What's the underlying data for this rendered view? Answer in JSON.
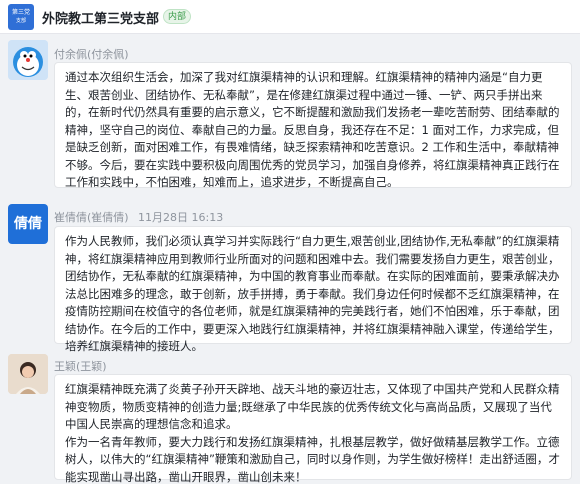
{
  "header": {
    "group_avatar_line1": "第三党",
    "group_avatar_line2": "支部",
    "title": "外院教工第三党支部",
    "badge": "内部"
  },
  "messages": [
    {
      "sender": "付余佩(付余佩)",
      "avatar_icon": "cartoon-avatar-icon",
      "text": "通过本次组织生活会，加深了我对红旗渠精神的认识和理解。红旗渠精神的精神内涵是“自力更生、艰苦创业、团结协作、无私奉献”，是在修建红旗渠过程中通过一锤、一铲、两只手拼出来的，在新时代仍然具有重要的启示意义，它不断提醒和激励我们发扬老一辈吃苦耐劳、团结奉献的精神，坚守自己的岗位、奉献自己的力量。反思自身，我还存在不足：1 面对工作，力求完成，但是缺乏创新，面对困难工作，有畏难情绪，缺乏探索精神和吃苦意识。2 工作和生活中，奉献精神不够。今后，要在实践中要积极向周围优秀的党员学习，加强自身修养，将红旗渠精神真正践行在工作和实践中，不怕困难，知难而上，追求进步，不断提高自己。"
    },
    {
      "sender": "崔倩倩(崔倩倩)",
      "avatar_text": "倩倩",
      "time": "11月28日 16:13",
      "text": "作为人民教师，我们必须认真学习并实际践行“自力更生,艰苦创业,团结协作,无私奉献”的红旗渠精神，将红旗渠精神应用到教师行业所面对的问题和困难中去。我们需要发扬自力更生，艰苦创业，团结协作，无私奉献的红旗渠精神，为中国的教育事业而奉献。在实际的困难面前，要秉承解决办法总比困难多的理念，敢于创新，放手拼搏，勇于奉献。我们身边任何时候都不乏红旗渠精神，在疫情防控期间在校值守的各位老师，就是红旗渠精神的完美践行者，她们不怕困难，乐于奉献，团结协作。在今后的工作中，要更深入地践行红旗渠精神，并将红旗渠精神融入课堂，传递给学生，培养红旗渠精神的接班人。"
    },
    {
      "sender": "王颖(王颖)",
      "avatar_icon": "photo-avatar-icon",
      "text": "红旗渠精神既充满了炎黄子孙开天辟地、战天斗地的豪迈壮志，又体现了中国共产党和人民群众精神变物质，物质变精神的创造力量;既继承了中华民族的优秀传统文化与高尚品质，又展现了当代中国人民崇高的理想信念和追求。\n作为一名青年教师，要大力践行和发扬红旗渠精神，扎根基层教学，做好做精基层教学工作。立德树人，以伟大的“红旗渠精神”鞭策和激励自己，同时以身作则，为学生做好榜样！走出舒适圈，才能实现凿山寻出路，凿山开眼界，凿山创未来！"
    }
  ],
  "colors": {
    "background": "#f0f2f5",
    "bubble": "#ffffff",
    "accent": "#1f6fd8",
    "badge": "#3a9b4a"
  }
}
